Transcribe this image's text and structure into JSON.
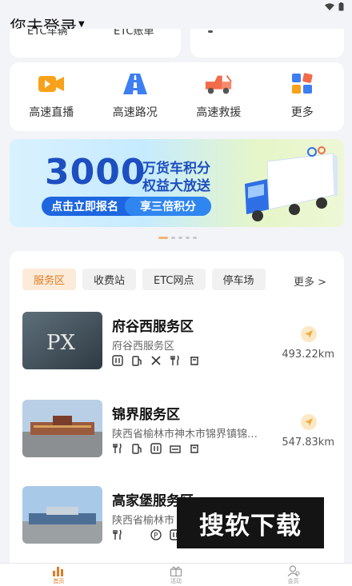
{
  "header": {
    "login_label": "您未登录"
  },
  "top_cards": {
    "left_text_1": "ETC车辆",
    "left_text_2": "ETC账单"
  },
  "quick_nav": [
    {
      "label": "高速直播",
      "icon": "video-camera-icon"
    },
    {
      "label": "高速路况",
      "icon": "road-icon"
    },
    {
      "label": "高速救援",
      "icon": "tow-truck-icon"
    },
    {
      "label": "更多",
      "icon": "grid-icon"
    }
  ],
  "banner": {
    "number": "3000",
    "line1": "万货车积分",
    "line2": "权益大放送",
    "cta_left": "点击立即报名",
    "cta_right": "享三倍积分"
  },
  "service": {
    "tabs": [
      "服务区",
      "收费站",
      "ETC网点",
      "停车场"
    ],
    "active_tab": "服务区",
    "more_label": "更多 >",
    "items": [
      {
        "name": "府谷西服务区",
        "address": "府谷西服务区",
        "distance": "493.22km"
      },
      {
        "name": "锦界服务区",
        "address": "陕西省榆林市神木市锦界镇锦…",
        "distance": "547.83km"
      },
      {
        "name": "高家堡服务区",
        "address": "陕西省榆林市",
        "distance": ""
      }
    ]
  },
  "watermark": "搜软下载",
  "bottom_nav": [
    {
      "label": "首页",
      "icon": "home-icon"
    },
    {
      "label": "活动",
      "icon": "gift-icon"
    },
    {
      "label": "会员",
      "icon": "member-icon"
    }
  ],
  "colors": {
    "accent": "#e07b24",
    "brand_blue": "#1d4fc1"
  }
}
